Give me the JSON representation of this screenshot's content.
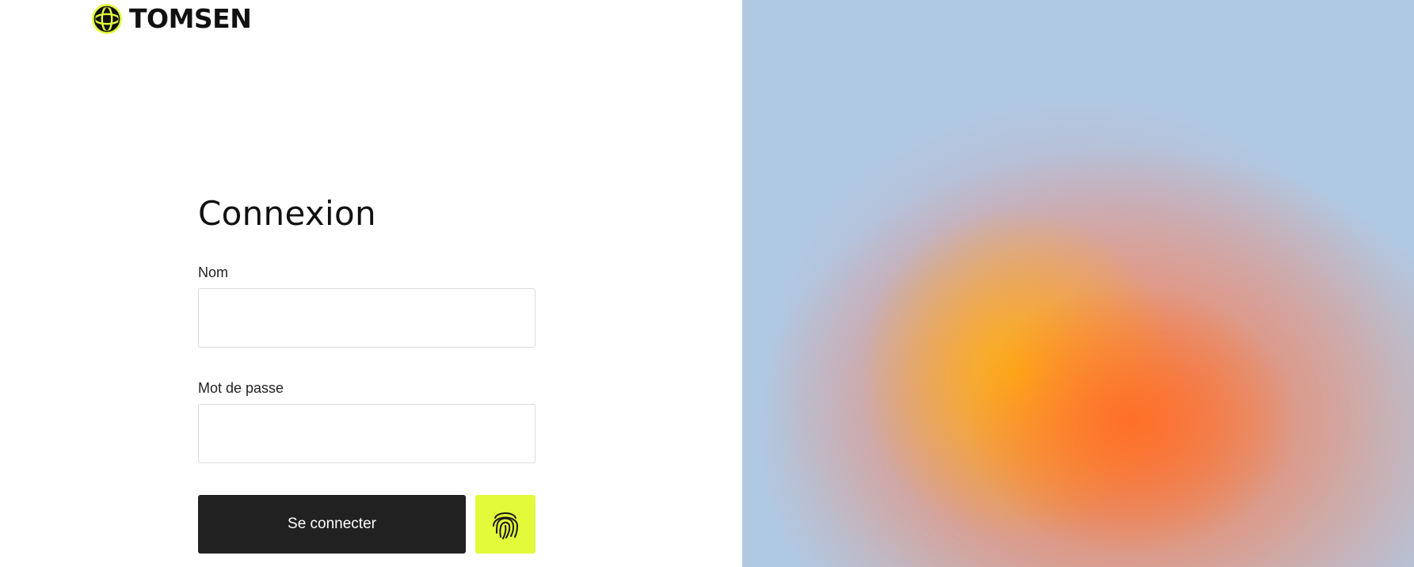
{
  "brand": {
    "name": "TOMSEN",
    "logo_icon": "globe-icon",
    "accent_color": "#e3fa3a"
  },
  "login": {
    "title": "Connexion",
    "name_label": "Nom",
    "name_value": "",
    "password_label": "Mot de passe",
    "password_value": "",
    "submit_label": "Se connecter",
    "biometric_icon": "fingerprint-icon"
  },
  "colors": {
    "button_dark": "#212121",
    "button_accent": "#e3fa3a",
    "panel_sky": "#b0c9e3",
    "panel_orange": "#fd7b34",
    "panel_yellow": "#f5ad1a"
  }
}
